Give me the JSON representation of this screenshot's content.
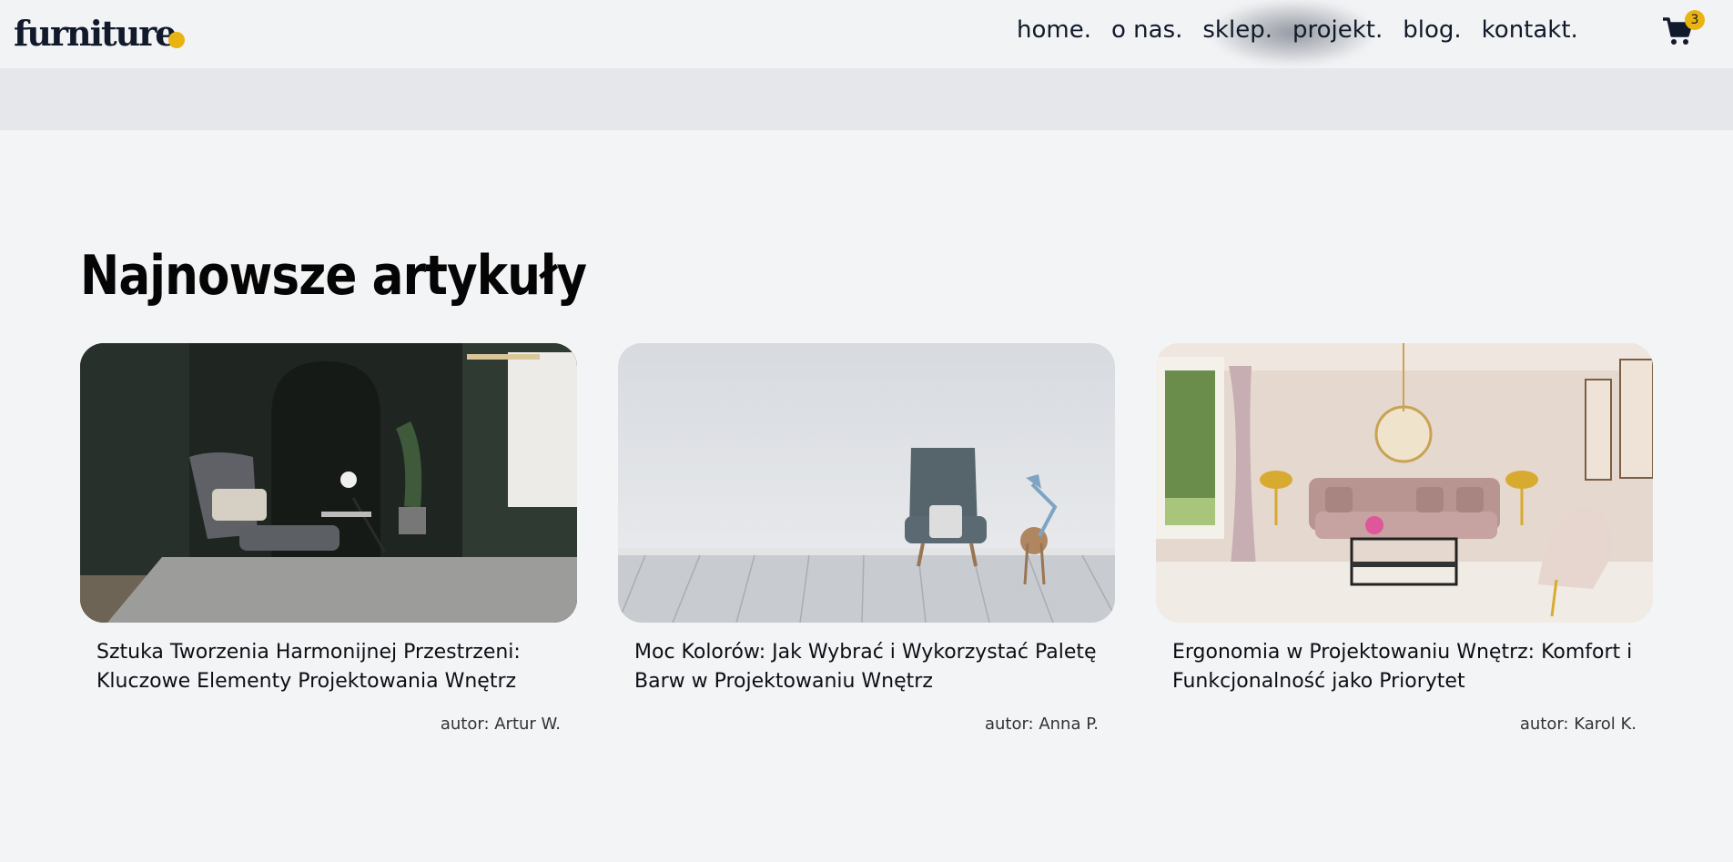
{
  "header": {
    "logo": "furniture",
    "nav": [
      "home.",
      "o nas.",
      "sklep.",
      "projekt.",
      "blog.",
      "kontakt."
    ],
    "cart_count": "3",
    "accent_color": "#e9b311"
  },
  "section": {
    "title": "Najnowsze artykuły"
  },
  "articles": [
    {
      "title": "Sztuka Tworzenia Harmonijnej Przestrzeni: Kluczowe Elementy Projektowania Wnętrz",
      "author": "autor: Artur W."
    },
    {
      "title": "Moc Kolorów: Jak Wybrać i Wykorzystać Paletę Barw w Projektowaniu Wnętrz",
      "author": "autor: Anna P."
    },
    {
      "title": "Ergonomia w Projektowaniu Wnętrz: Komfort i Funkcjonalność jako Priorytet",
      "author": "autor: Karol K."
    }
  ]
}
